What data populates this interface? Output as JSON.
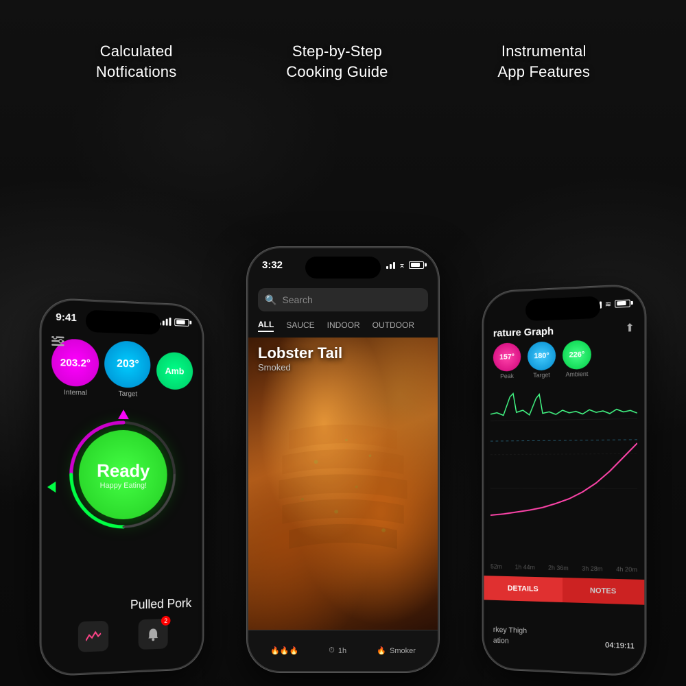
{
  "background": {
    "color": "#0a0a0a"
  },
  "header": {
    "label1": "Calculated\nNotfications",
    "label2": "Step-by-Step\nCooking Guide",
    "label3": "Instrumental\nApp Features"
  },
  "left_phone": {
    "status_time": "9:41",
    "internal_temp": "203.2°",
    "target_temp": "203°",
    "ambient_label": "Amb",
    "internal_label": "Internal",
    "target_label": "Target",
    "ready_text": "Ready",
    "ready_sub": "Happy Eating!",
    "meat_name": "Pulled Pork",
    "badge_count": "2"
  },
  "center_phone": {
    "status_time": "3:32",
    "search_placeholder": "Search",
    "tabs": [
      "ALL",
      "SAUCE",
      "INDOOR",
      "OUTDOOR"
    ],
    "active_tab": "ALL",
    "recipe_name": "Lobster Tail",
    "recipe_method": "Smoked",
    "bottom_fire": "🔥",
    "bottom_time": "1h",
    "bottom_smoker": "Smoker"
  },
  "right_phone": {
    "status_time": "",
    "title": "rature Graph",
    "peak_temp": "157°",
    "target_temp": "180°",
    "ambient_temp": "226°",
    "peak_label": "Peak",
    "target_label": "Target",
    "ambient_label": "Ambient",
    "timeline": [
      "52m",
      "1h 44m",
      "2h 36m",
      "3h 28m",
      "4h 20m"
    ],
    "tab_details": "DETAILS",
    "tab_notes": "NOTES",
    "detail_meat": "rkey Thigh",
    "detail_label2": "ation",
    "detail_time": "04:19:11",
    "share_icon": "⬆"
  }
}
